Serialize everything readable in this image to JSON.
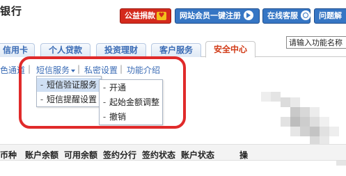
{
  "header": {
    "logo_text": "银行",
    "charity_label": "公益捐款",
    "register_label": "网站会员一键注册",
    "service_label": "在线客服",
    "help_label": "问题解"
  },
  "search": {
    "value": "请输入功能名称"
  },
  "tabs": [
    {
      "label": "信用卡"
    },
    {
      "label": "个人贷款"
    },
    {
      "label": "投资理财"
    },
    {
      "label": "客户服务"
    },
    {
      "label": "安全中心",
      "active": true
    }
  ],
  "subnav": {
    "item_partial": "色通道",
    "sms_service": "短信服务",
    "privacy": "私密设置",
    "features": "功能介绍"
  },
  "menu_level1": [
    {
      "label": "短信验证服务",
      "highlighted": true,
      "has_submenu": true
    },
    {
      "label": "短信提醒设置"
    }
  ],
  "menu_level2": [
    {
      "label": "开通"
    },
    {
      "label": "起始金额调整"
    },
    {
      "label": "撤销"
    }
  ],
  "table": {
    "columns": [
      "币种",
      "账户余额",
      "可用余额",
      "签约分行",
      "签约状态",
      "账户状态",
      "操"
    ]
  },
  "colors": {
    "annotation": "#e02a2a",
    "link": "#3a6bb5",
    "active_tab_text": "#d13a16",
    "header_button": "#3676c4",
    "charity_button": "#d42a1d"
  }
}
